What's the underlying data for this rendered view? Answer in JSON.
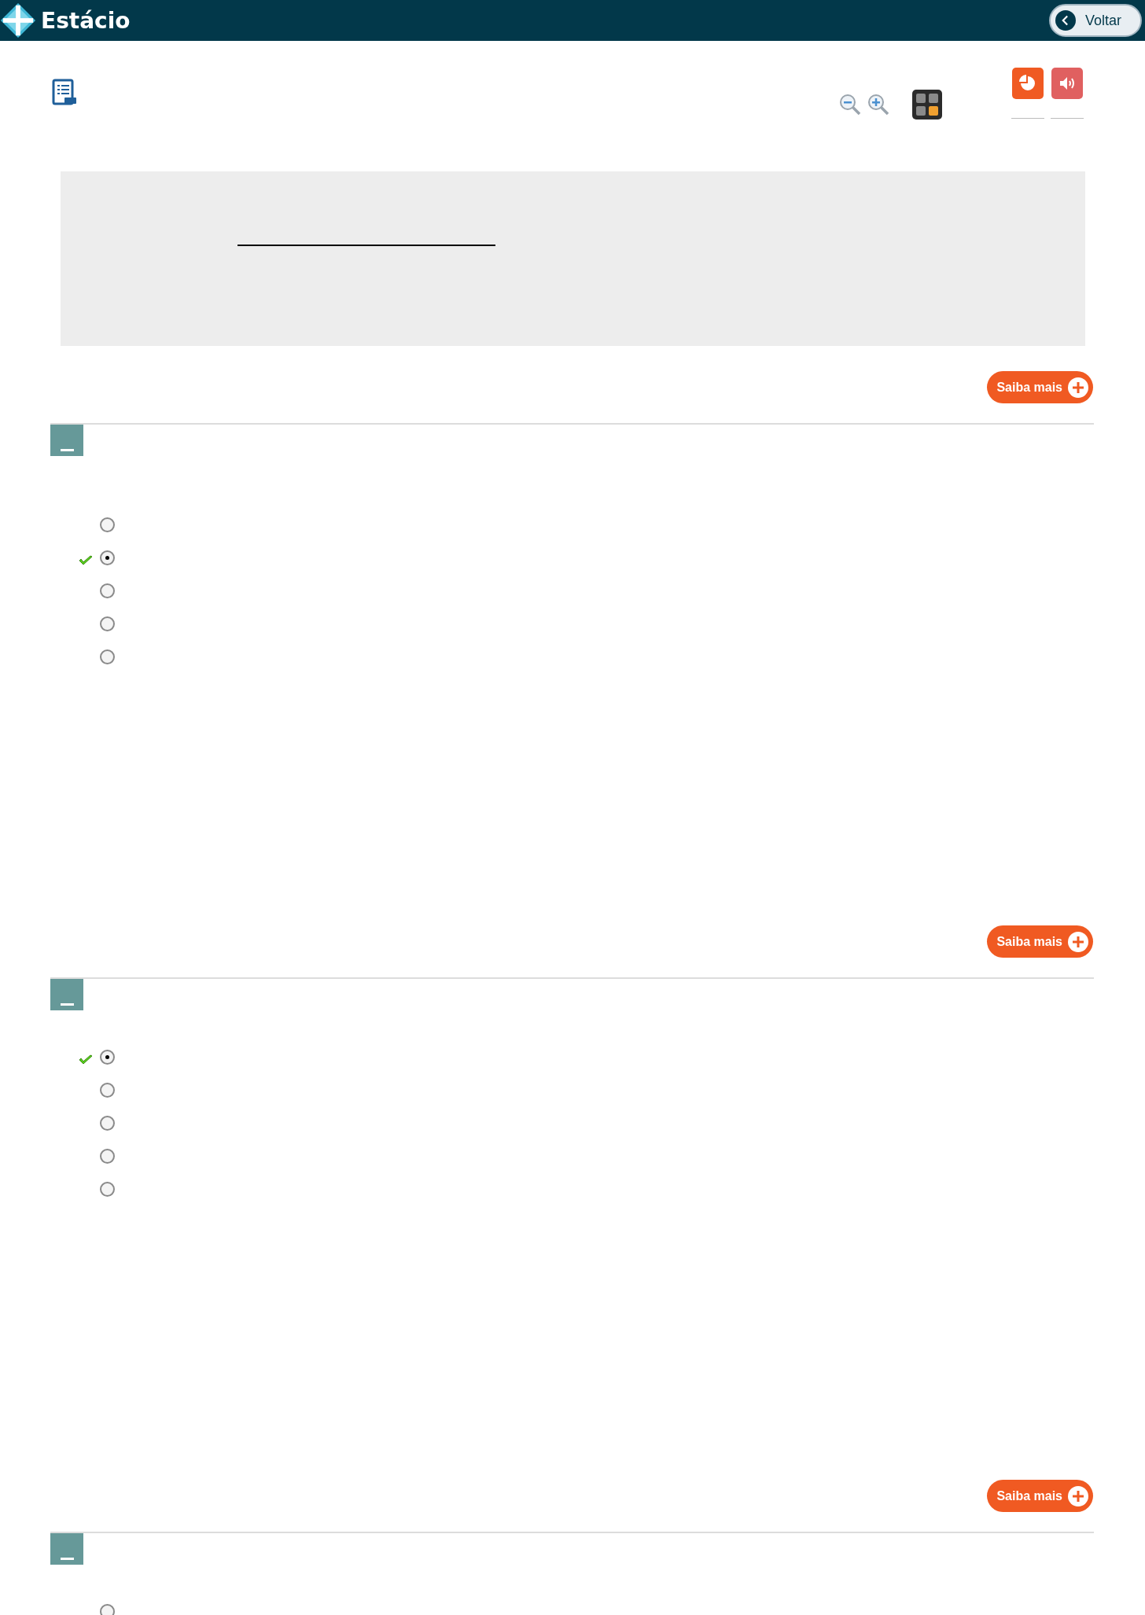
{
  "header": {
    "brand": "Estácio",
    "back_button": "Voltar"
  },
  "questions": [
    {
      "more_button": "Saiba mais",
      "options": [
        {
          "selected": false,
          "correct": false
        },
        {
          "selected": true,
          "correct": true
        },
        {
          "selected": false,
          "correct": false
        },
        {
          "selected": false,
          "correct": false
        },
        {
          "selected": false,
          "correct": false
        }
      ]
    },
    {
      "more_button": "Saiba mais",
      "options": [
        {
          "selected": true,
          "correct": true
        },
        {
          "selected": false,
          "correct": false
        },
        {
          "selected": false,
          "correct": false
        },
        {
          "selected": false,
          "correct": false
        },
        {
          "selected": false,
          "correct": false
        }
      ]
    },
    {
      "more_button": "Saiba mais",
      "options": [
        {
          "selected": false,
          "correct": false
        }
      ]
    }
  ]
}
